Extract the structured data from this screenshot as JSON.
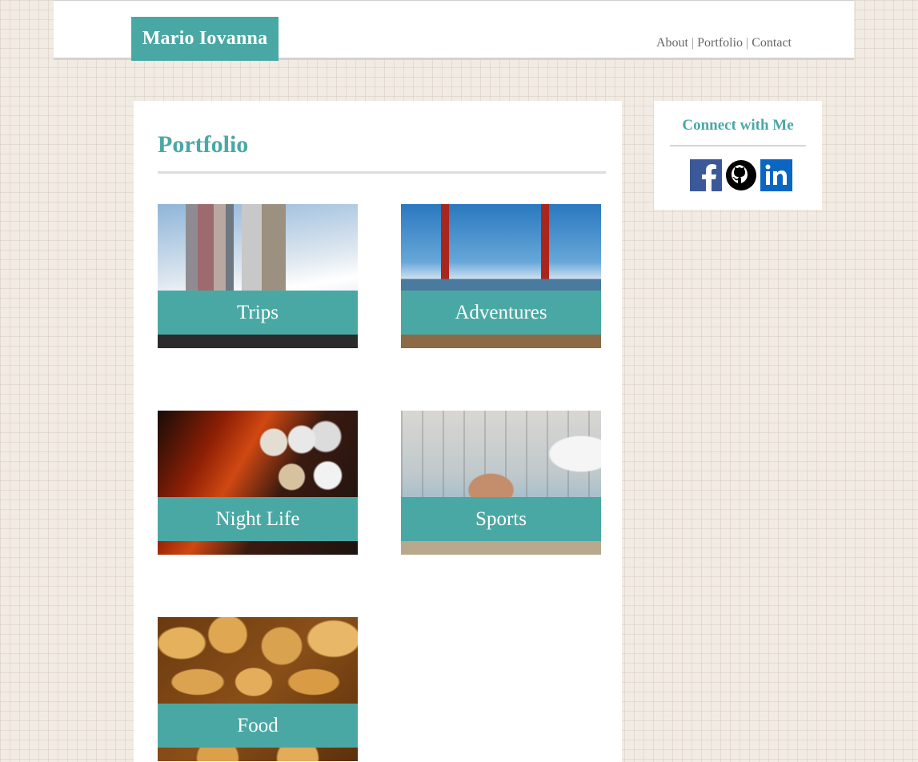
{
  "header": {
    "brand": "Mario Iovanna",
    "nav": [
      {
        "label": "About"
      },
      {
        "label": "Portfolio"
      },
      {
        "label": "Contact"
      }
    ],
    "separator": "|"
  },
  "main": {
    "title": "Portfolio",
    "cards": [
      {
        "label": "Trips"
      },
      {
        "label": "Adventures"
      },
      {
        "label": "Night Life"
      },
      {
        "label": "Sports"
      },
      {
        "label": "Food"
      }
    ]
  },
  "sidebar": {
    "title": "Connect with Me",
    "socials": [
      {
        "icon": "facebook-icon",
        "color": "#3b5998"
      },
      {
        "icon": "github-icon",
        "color": "#000000"
      },
      {
        "icon": "linkedin-icon",
        "color": "#0a66c2"
      }
    ]
  },
  "colors": {
    "accent": "#4aa8a4",
    "page_background": "#f1ebe3"
  }
}
